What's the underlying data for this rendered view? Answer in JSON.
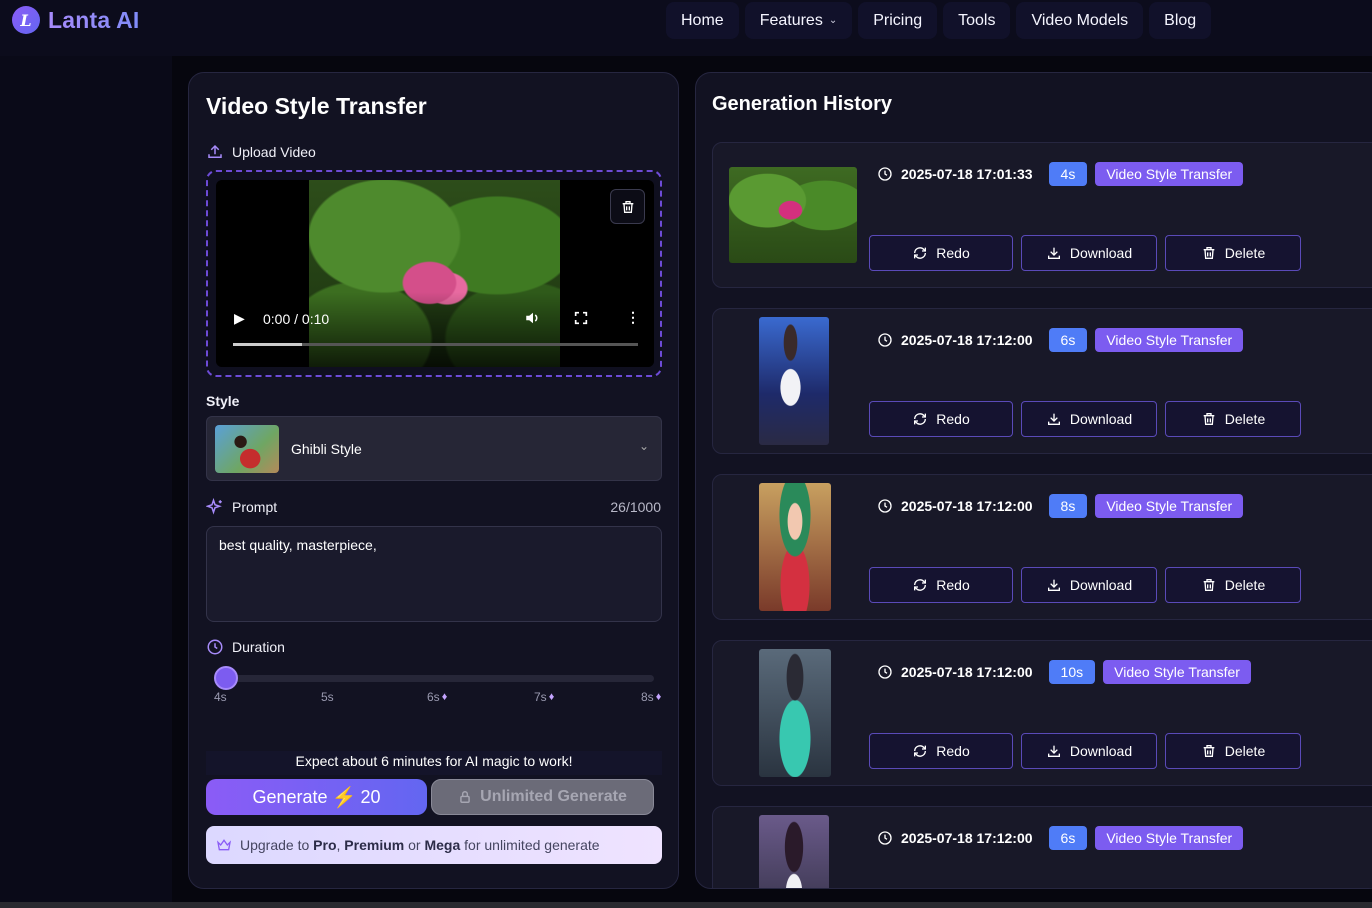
{
  "brand": {
    "name": "Lanta AI",
    "mark": "L"
  },
  "nav": {
    "items": [
      {
        "label": "Home"
      },
      {
        "label": "Features",
        "has_dropdown": true
      },
      {
        "label": "Pricing"
      },
      {
        "label": "Tools"
      },
      {
        "label": "Video Models"
      },
      {
        "label": "Blog"
      }
    ]
  },
  "form": {
    "title": "Video Style Transfer",
    "upload_label": "Upload Video",
    "video": {
      "time": "0:00 / 0:10",
      "progress": 0.17
    },
    "style_label": "Style",
    "style_value": "Ghibli Style",
    "prompt_label": "Prompt",
    "prompt_count": "26/1000",
    "prompt_value": "best quality, masterpiece,",
    "duration_label": "Duration",
    "duration_ticks": [
      {
        "label": "4s",
        "premium": false
      },
      {
        "label": "5s",
        "premium": false
      },
      {
        "label": "6s",
        "premium": true
      },
      {
        "label": "7s",
        "premium": true
      },
      {
        "label": "8s",
        "premium": true
      }
    ],
    "duration_value": "4s",
    "notice": "Expect about 6 minutes for AI magic to work!",
    "generate_label": "Generate",
    "generate_cost": "20",
    "unlimited_label": "Unlimited Generate",
    "upgrade": {
      "prefix": "Upgrade to",
      "pro": "Pro",
      "sep1": ",",
      "premium": "Premium",
      "or": "or",
      "mega": "Mega",
      "suffix": "for unlimited generate"
    }
  },
  "history": {
    "title": "Generation History",
    "buttons": {
      "redo": "Redo",
      "download": "Download",
      "delete": "Delete"
    },
    "items": [
      {
        "date": "2025-07-18 17:01:33",
        "duration": "4s",
        "type": "Video Style Transfer",
        "thumb": "lotus-flower"
      },
      {
        "date": "2025-07-18 17:12:00",
        "duration": "6s",
        "type": "Video Style Transfer",
        "thumb": "anime-girl-stage"
      },
      {
        "date": "2025-07-18 17:12:00",
        "duration": "8s",
        "type": "Video Style Transfer",
        "thumb": "anime-girl-green-hair"
      },
      {
        "date": "2025-07-18 17:12:00",
        "duration": "10s",
        "type": "Video Style Transfer",
        "thumb": "anime-girl-kimono"
      },
      {
        "date": "2025-07-18 17:12:00",
        "duration": "6s",
        "type": "Video Style Transfer",
        "thumb": "anime-girl-dark"
      }
    ]
  },
  "colors": {
    "accent": "#7c5cf0",
    "duration_badge": "#4f7cf7",
    "bg": "#0b0b1a"
  }
}
